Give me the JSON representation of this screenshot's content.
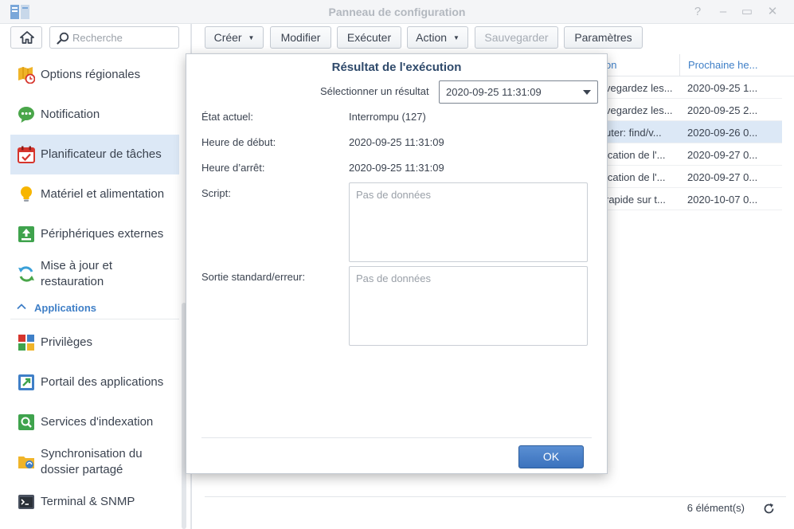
{
  "window": {
    "title": "Panneau de configuration",
    "controls": [
      "?",
      "–",
      "▭",
      "✕"
    ]
  },
  "sidebar": {
    "search_placeholder": "Recherche",
    "items": [
      {
        "label": "Options régionales",
        "icon": "regional-options-icon"
      },
      {
        "label": "Notification",
        "icon": "notification-icon"
      },
      {
        "label": "Planificateur de tâches",
        "icon": "task-scheduler-icon",
        "active": true
      },
      {
        "label": "Matériel et alimentation",
        "icon": "hardware-power-icon"
      },
      {
        "label": "Périphériques externes",
        "icon": "external-devices-icon"
      },
      {
        "label": "Mise à jour et",
        "label2": "restauration",
        "icon": "update-restore-icon"
      }
    ],
    "section": "Applications",
    "app_items": [
      {
        "label": "Privilèges",
        "icon": "privileges-icon"
      },
      {
        "label": "Portail des applications",
        "icon": "application-portal-icon"
      },
      {
        "label": "Services d'indexation",
        "icon": "indexing-service-icon"
      },
      {
        "label": "Synchronisation du",
        "label2": "dossier partagé",
        "icon": "shared-folder-sync-icon"
      },
      {
        "label": "Terminal & SNMP",
        "icon": "terminal-icon"
      }
    ]
  },
  "toolbar": {
    "create": "Créer",
    "edit": "Modifier",
    "run": "Exécuter",
    "action": "Action",
    "save": "Sauvegarder",
    "settings": "Paramètres"
  },
  "grid": {
    "columns": [
      "on",
      "Prochaine he..."
    ],
    "rows": [
      {
        "action": "vegardez les...",
        "next": "2020-09-25 1..."
      },
      {
        "action": "vegardez les...",
        "next": "2020-09-25 2..."
      },
      {
        "action": "uter: find/v...",
        "next": "2020-09-26 0...",
        "selected": true
      },
      {
        "action": "ication de l'...",
        "next": "2020-09-27 0..."
      },
      {
        "action": "ication de l'...",
        "next": "2020-09-27 0..."
      },
      {
        "action": "rapide sur t...",
        "next": "2020-10-07 0..."
      }
    ],
    "count": "6 élément(s)"
  },
  "dialog": {
    "title": "Résultat de l'exécution",
    "select_label": "Sélectionner un résultat",
    "select_value": "2020-09-25 11:31:09",
    "state_label": "État actuel:",
    "state_value": "Interrompu (127)",
    "start_label": "Heure de début:",
    "start_value": "2020-09-25 11:31:09",
    "stop_label": "Heure d’arrêt:",
    "stop_value": "2020-09-25 11:31:09",
    "script_label": "Script:",
    "script_placeholder": "Pas de données",
    "output_label": "Sortie standard/erreur:",
    "output_placeholder": "Pas de données",
    "ok": "OK"
  },
  "colors": {
    "accent": "#3f7fc7",
    "active_bg": "#dce8f6",
    "ok_button": "#3b72bd"
  }
}
